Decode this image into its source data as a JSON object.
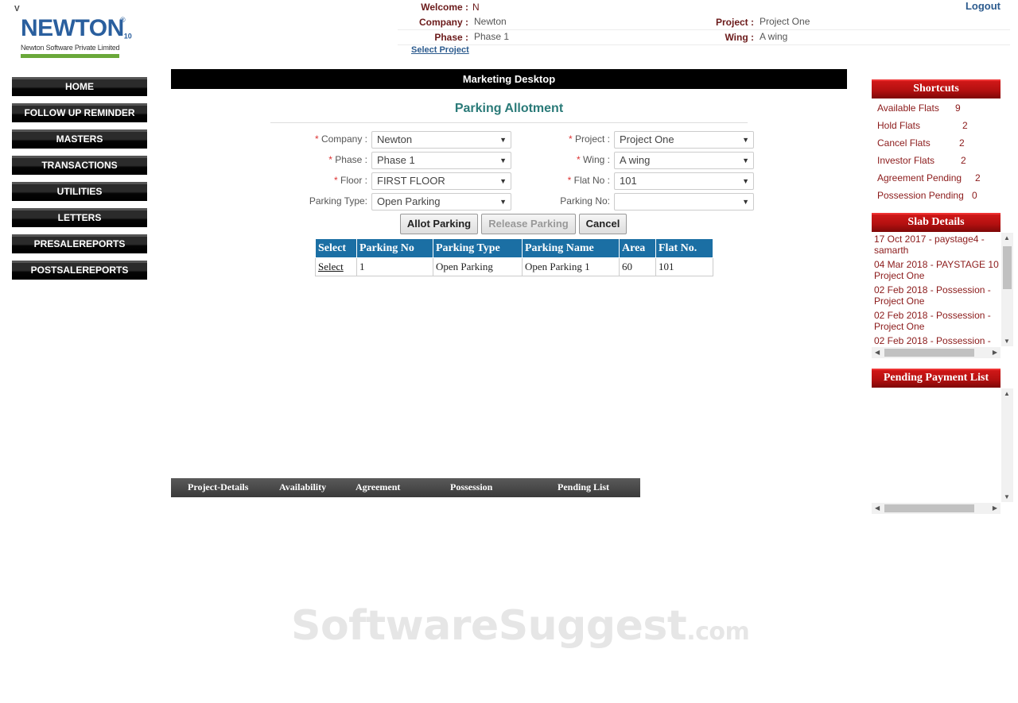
{
  "app": {
    "logo_mark": "V",
    "logo_word": "NEWTON",
    "logo_ten": "10",
    "logo_reg": "®",
    "logo_sub": "Newton Software Private Limited"
  },
  "header": {
    "welcome_label": "Welcome :",
    "welcome_value": "N",
    "company_label": "Company :",
    "company_value": "Newton",
    "project_label": "Project :",
    "project_value": "Project One",
    "phase_label": "Phase :",
    "phase_value": "Phase 1",
    "wing_label": "Wing :",
    "wing_value": "A wing",
    "select_project": "Select Project",
    "logout": "Logout"
  },
  "menu": {
    "items": [
      "HOME",
      "FOLLOW UP REMINDER",
      "MASTERS",
      "TRANSACTIONS",
      "UTILITIES",
      "LETTERS",
      "PRESALEREPORTS",
      "POSTSALEREPORTS"
    ]
  },
  "desk": {
    "bar_title": "Marketing Desktop",
    "page_title": "Parking Allotment"
  },
  "form": {
    "required_mark": "*",
    "company": {
      "label": "Company :",
      "value": "Newton"
    },
    "project": {
      "label": "Project :",
      "value": "Project One"
    },
    "phase": {
      "label": "Phase :",
      "value": "Phase 1"
    },
    "wing": {
      "label": "Wing :",
      "value": "A wing"
    },
    "floor": {
      "label": "Floor :",
      "value": "FIRST FLOOR"
    },
    "flat_no": {
      "label": "Flat No :",
      "value": "101"
    },
    "parking_type": {
      "label": "Parking Type:",
      "value": "Open Parking"
    },
    "parking_no": {
      "label": "Parking No:",
      "value": ""
    },
    "dropdown_arrow": "▼"
  },
  "buttons": {
    "allot": "Allot Parking",
    "release": "Release Parking",
    "cancel": "Cancel"
  },
  "grid": {
    "headers": [
      "Select",
      "Parking No",
      "Parking Type",
      "Parking Name",
      "Area",
      "Flat No."
    ],
    "rows": [
      [
        "Select",
        "1",
        "Open Parking",
        "Open Parking 1",
        "60",
        "101"
      ]
    ]
  },
  "bottom_tabs": [
    "Project-Details",
    "Availability",
    "Agreement",
    "Possession",
    "Pending List"
  ],
  "shortcuts": {
    "title": "Shortcuts",
    "items": [
      {
        "label": "Available Flats",
        "count": "9"
      },
      {
        "label": "Hold Flats",
        "count": "2"
      },
      {
        "label": "Cancel Flats",
        "count": "2"
      },
      {
        "label": "Investor Flats",
        "count": "2"
      },
      {
        "label": "Agreement Pending",
        "count": "2"
      },
      {
        "label": "Possession Pending",
        "count": "0"
      }
    ]
  },
  "slab": {
    "title": "Slab Details",
    "items": [
      "17 Oct 2017 - paystage4 - samarth",
      "04 Mar 2018 - PAYSTAGE 10 Project One",
      "02 Feb 2018 - Possession - Project One",
      "02 Feb 2018 - Possession - Project One",
      "02 Feb 2018 - Possession -"
    ]
  },
  "pending": {
    "title": "Pending Payment List"
  },
  "watermark": {
    "main": "SoftwareSuggest",
    "suffix": ".com"
  }
}
